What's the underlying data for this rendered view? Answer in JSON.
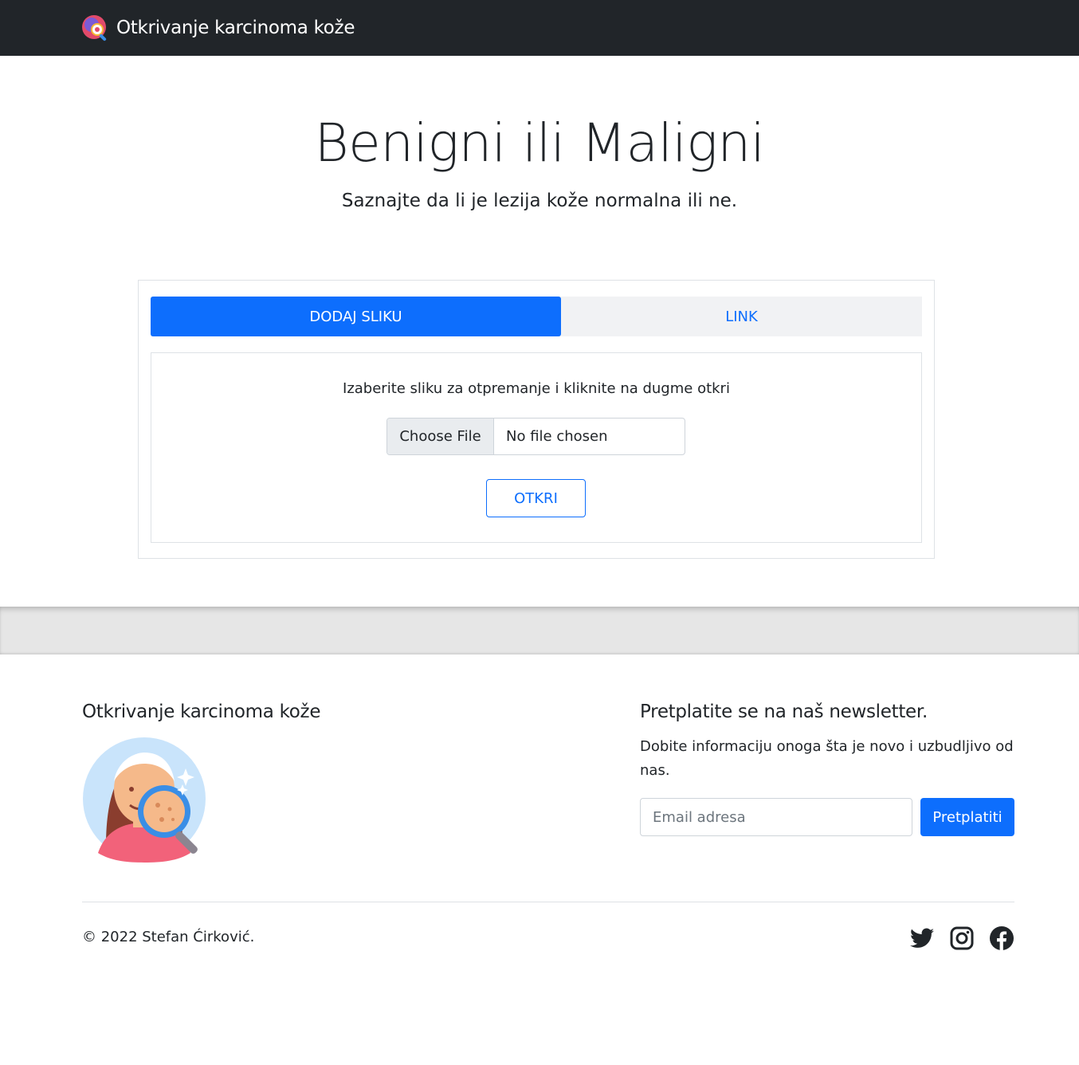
{
  "navbar": {
    "brand_text": "Otkrivanje karcinoma kože",
    "brand_icon": "skin-magnifier-logo-icon"
  },
  "hero": {
    "title": "Benigni ili Maligni",
    "subtitle": "Saznajte da li je lezija kože normalna ili ne."
  },
  "upload": {
    "tabs": [
      {
        "label": "DODAJ SLIKU",
        "active": true
      },
      {
        "label": "LINK",
        "active": false
      }
    ],
    "instruction": "Izaberite sliku za otpremanje i kliknite na dugme otkri",
    "file_button_label": "Choose File",
    "file_status": "No file chosen",
    "detect_label": "OTKRI"
  },
  "footer": {
    "left_title": "Otkrivanje karcinoma kože",
    "illustration_icon": "skin-check-illustration-icon",
    "newsletter_title": "Pretplatite se na naš newsletter.",
    "newsletter_text": "Dobite informaciju onoga šta je novo i uzbudljivo od nas.",
    "email_placeholder": "Email adresa",
    "email_value": "",
    "subscribe_label": "Pretplatiti",
    "copyright": "© 2022 Stefan Ćirković.",
    "socials": [
      "twitter-icon",
      "instagram-icon",
      "facebook-icon"
    ]
  },
  "colors": {
    "navbar_bg": "#212529",
    "primary": "#0d6efd",
    "tab_bg": "#f1f2f4",
    "text": "#212529",
    "band_bg": "#e6e6e6"
  }
}
